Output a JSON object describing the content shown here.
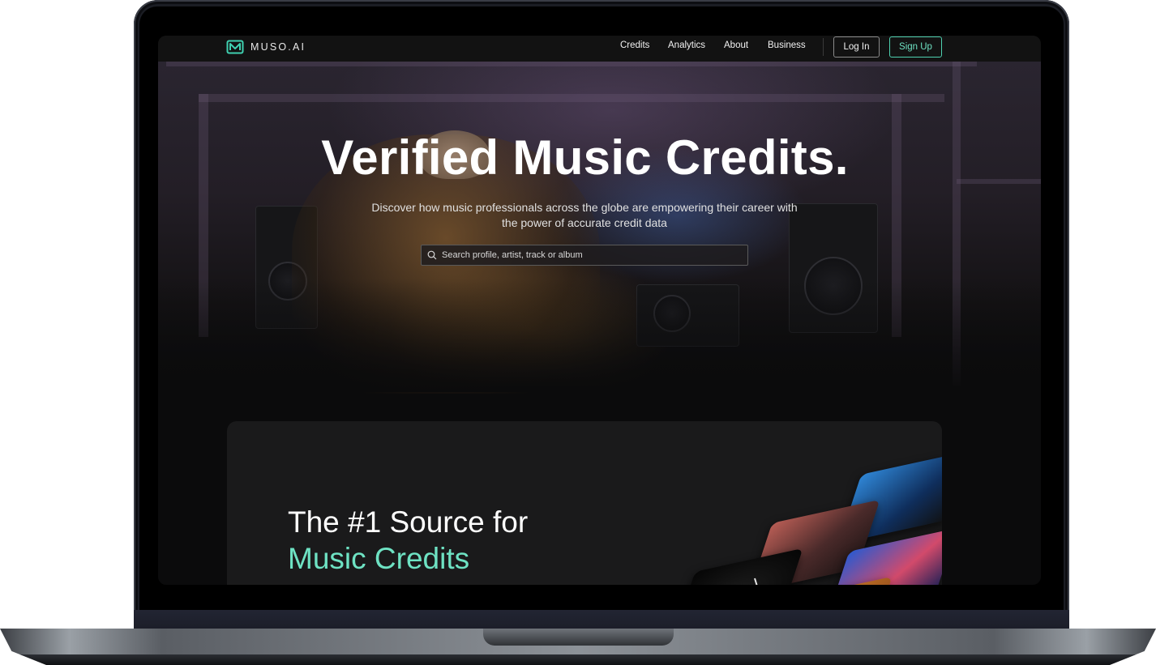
{
  "brand": {
    "name": "MUSO.AI",
    "accent_color": "#6ee2c3"
  },
  "nav": {
    "links": [
      "Credits",
      "Analytics",
      "About",
      "Business"
    ],
    "login_label": "Log In",
    "signup_label": "Sign Up"
  },
  "hero": {
    "title": "Verified Music Credits.",
    "subtitle": "Discover how music professionals across the globe are empowering their career with the power of accurate credit data",
    "search_placeholder": "Search profile, artist, track or album"
  },
  "feature": {
    "title_line1": "The #1 Source for",
    "title_line2": "Music Credits"
  }
}
